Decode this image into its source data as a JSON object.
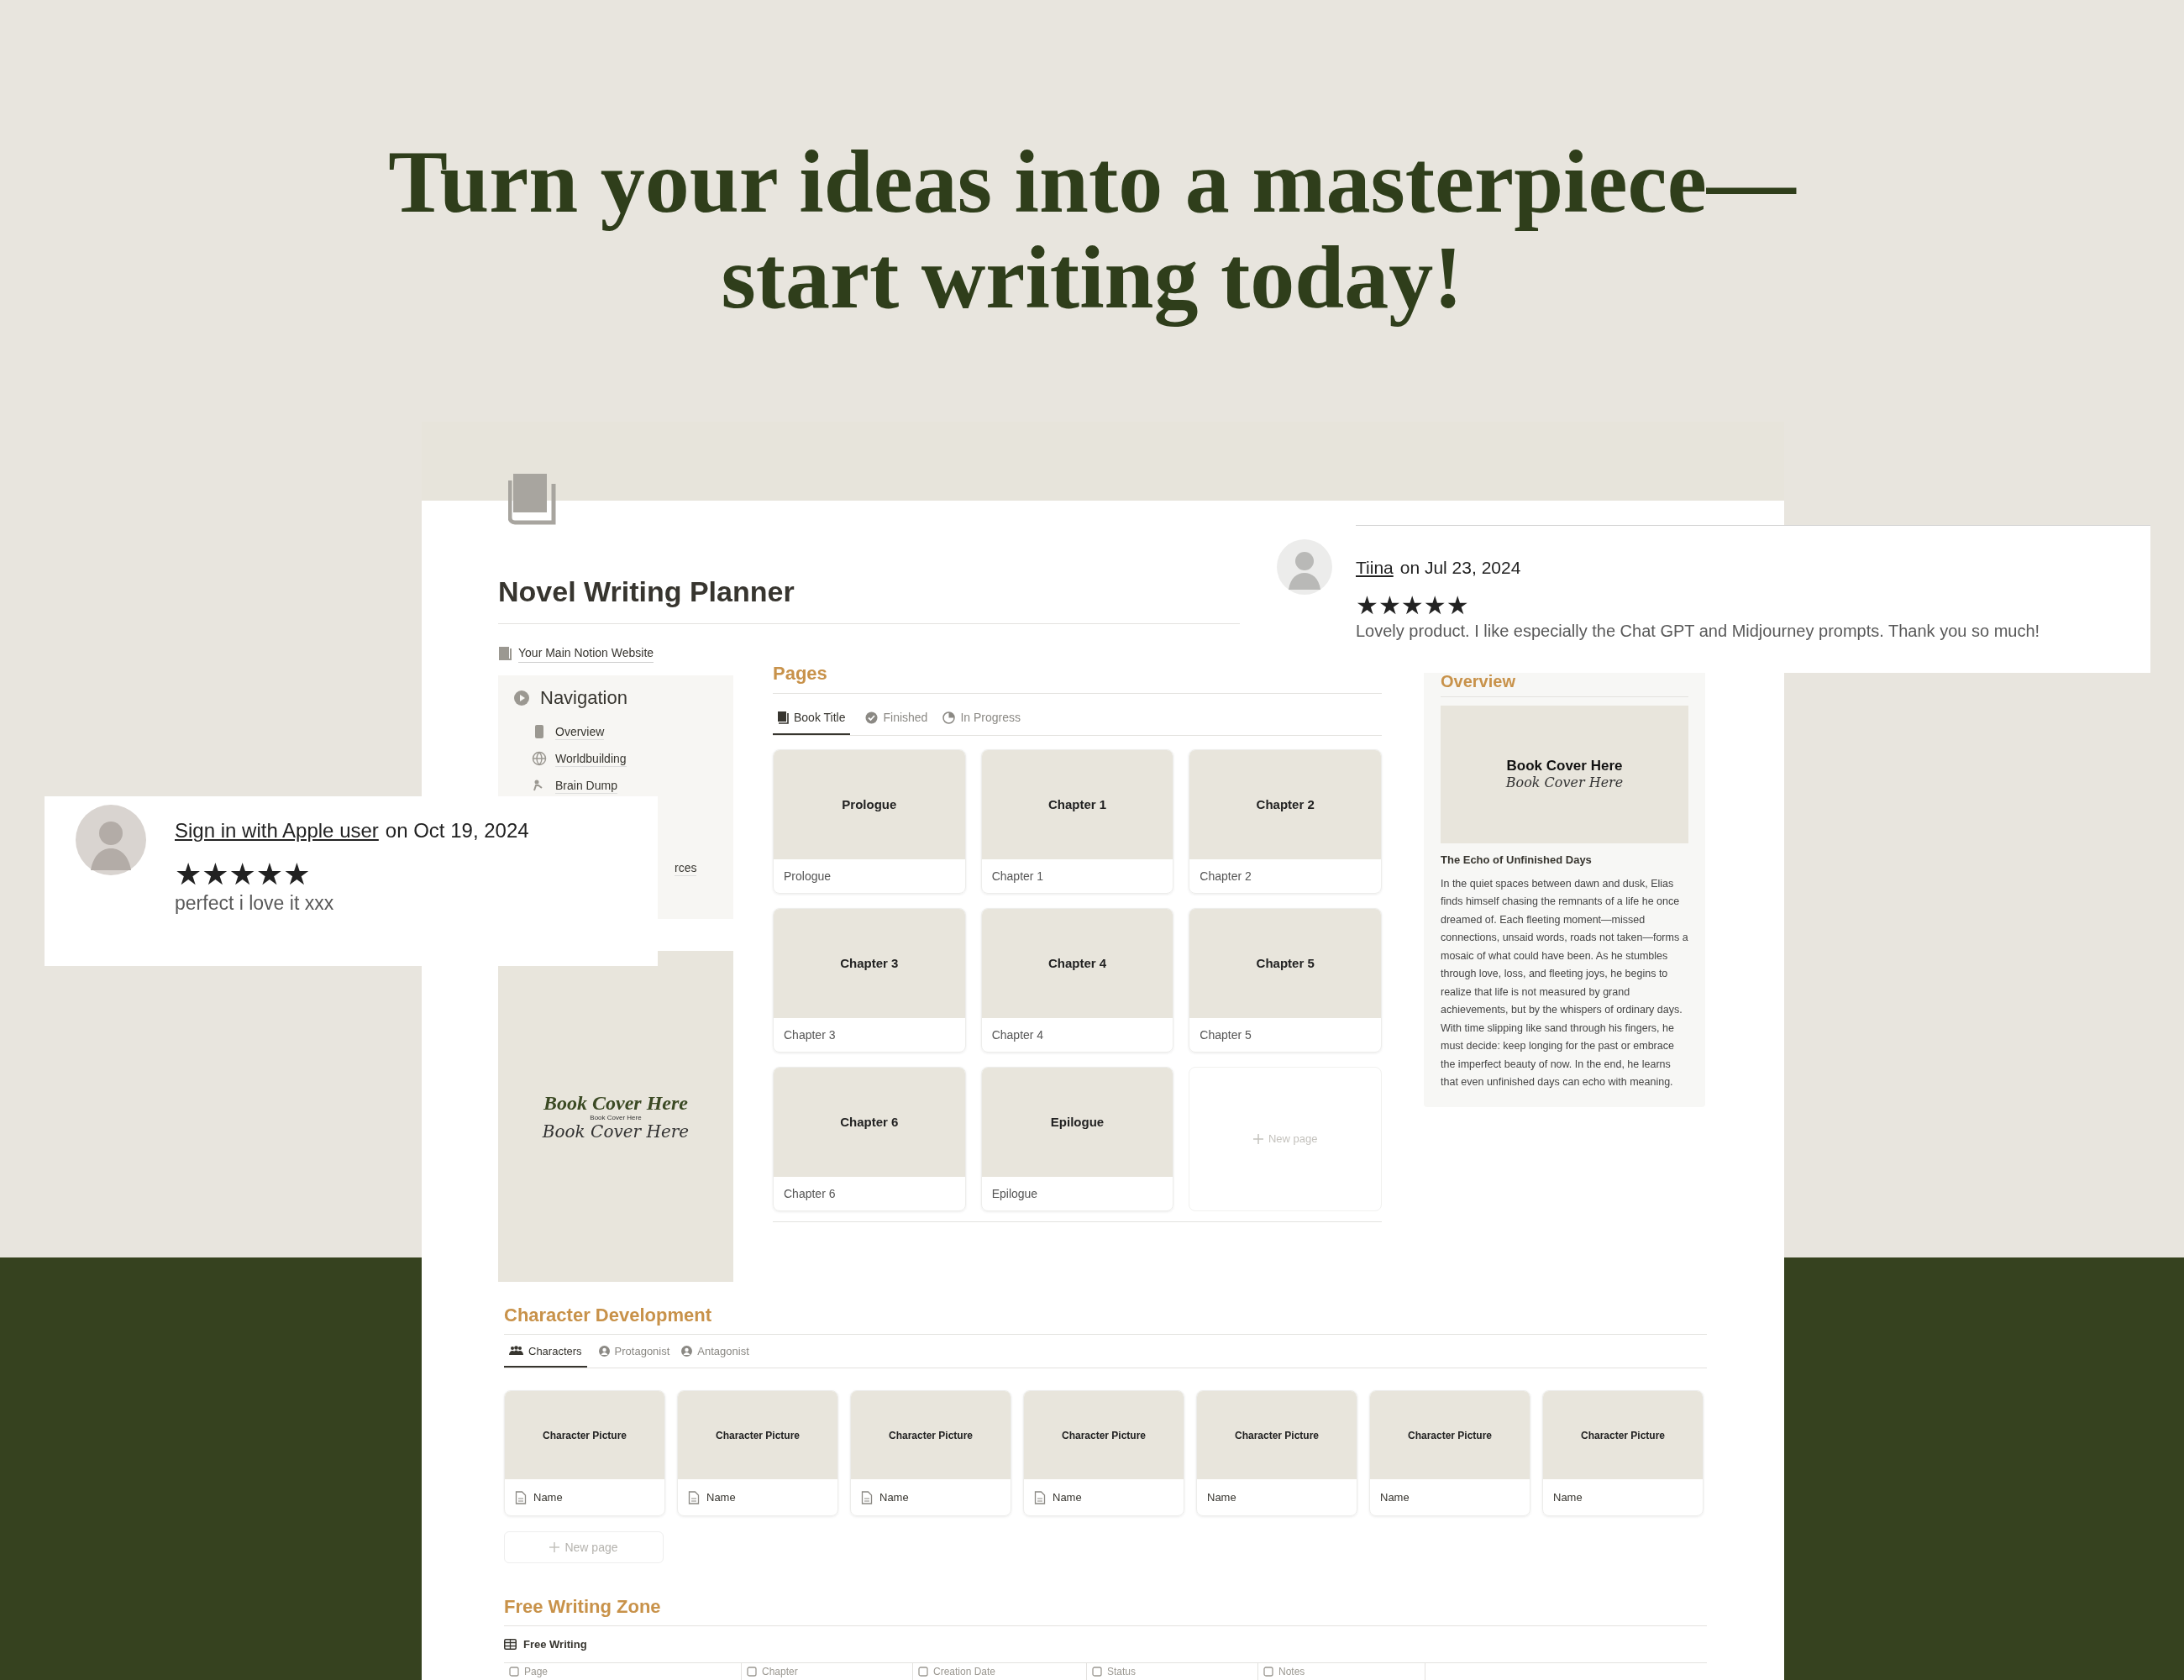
{
  "headline": "Turn your ideas into a masterpiece—start writing today!",
  "page": {
    "title": "Novel Writing Planner",
    "link": "Your Main Notion Website",
    "navigation": {
      "title": "Navigation",
      "items": [
        {
          "label": "Overview"
        },
        {
          "label": "Worldbuilding"
        },
        {
          "label": "Brain Dump"
        },
        {
          "label": "rces"
        }
      ]
    },
    "side_cover": [
      "Book Cover Here",
      "Book Cover Here",
      "Book Cover Here"
    ],
    "pages_section": {
      "title": "Pages",
      "tabs": [
        {
          "label": "Book Title",
          "selected": true
        },
        {
          "label": "Finished",
          "selected": false
        },
        {
          "label": "In Progress",
          "selected": false
        }
      ],
      "cards": [
        {
          "cover": "Prologue",
          "title": "Prologue"
        },
        {
          "cover": "Chapter 1",
          "title": "Chapter 1"
        },
        {
          "cover": "Chapter 2",
          "title": "Chapter 2"
        },
        {
          "cover": "Chapter 3",
          "title": "Chapter 3"
        },
        {
          "cover": "Chapter 4",
          "title": "Chapter 4"
        },
        {
          "cover": "Chapter 5",
          "title": "Chapter 5"
        },
        {
          "cover": "Chapter 6",
          "title": "Chapter 6"
        },
        {
          "cover": "Epilogue",
          "title": "Epilogue"
        }
      ],
      "new_page": "New page"
    },
    "overview": {
      "title": "Overview",
      "cover": [
        "Book Cover Here",
        "Book Cover Here"
      ],
      "book_title": "The Echo of Unfinished Days",
      "summary": "In the quiet spaces between dawn and dusk, Elias finds himself chasing the remnants of a life he once dreamed of. Each fleeting moment—missed connections, unsaid words, roads not taken—forms a mosaic of what could have been. As he stumbles through love, loss, and fleeting joys, he begins to realize that life is not measured by grand achievements, but by the whispers of ordinary days. With time slipping like sand through his fingers, he must decide: keep longing for the past or embrace the imperfect beauty of now. In the end, he learns that even unfinished days can echo with meaning."
    },
    "characters_section": {
      "title": "Character Development",
      "tabs": [
        {
          "label": "Characters",
          "selected": true
        },
        {
          "label": "Protagonist",
          "selected": false
        },
        {
          "label": "Antagonist",
          "selected": false
        }
      ],
      "cards": [
        {
          "cover": "Character Picture",
          "title": "Name",
          "has_icon": true
        },
        {
          "cover": "Character Picture",
          "title": "Name",
          "has_icon": true
        },
        {
          "cover": "Character Picture",
          "title": "Name",
          "has_icon": true
        },
        {
          "cover": "Character Picture",
          "title": "Name",
          "has_icon": true
        },
        {
          "cover": "Character Picture",
          "title": "Name",
          "has_icon": false
        },
        {
          "cover": "Character Picture",
          "title": "Name",
          "has_icon": false
        },
        {
          "cover": "Character Picture",
          "title": "Name",
          "has_icon": false
        }
      ],
      "new_page": "New page"
    },
    "free_writing_section": {
      "title": "Free Writing Zone",
      "tabs": [
        {
          "label": "Free Writing",
          "selected": true
        }
      ],
      "columns": [
        "Page",
        "Chapter",
        "Creation Date",
        "Status",
        "Notes"
      ]
    }
  },
  "reviews": [
    {
      "author": "Tiina",
      "date_text": "on Jul 23, 2024",
      "stars": 5,
      "text": "Lovely product. I like especially the Chat GPT and Midjourney prompts. Thank you so much!"
    },
    {
      "author": "Sign in with Apple user",
      "date_text": "on Oct 19, 2024",
      "stars": 5,
      "text": "perfect i love it xxx"
    }
  ]
}
